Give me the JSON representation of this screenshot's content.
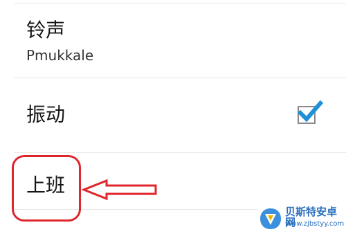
{
  "settings": {
    "ringtone": {
      "label": "铃声",
      "value": "Pmukkale"
    },
    "vibrate": {
      "label": "振动",
      "checked": true
    },
    "work": {
      "label": "上班"
    }
  },
  "annotation": {
    "color": "#e0262d"
  },
  "watermark": {
    "title": "贝斯特安卓网",
    "url": "www.zjbstyy.com"
  },
  "colors": {
    "checkmark": "#1e90d6",
    "watermark": "#2a6fbd"
  }
}
